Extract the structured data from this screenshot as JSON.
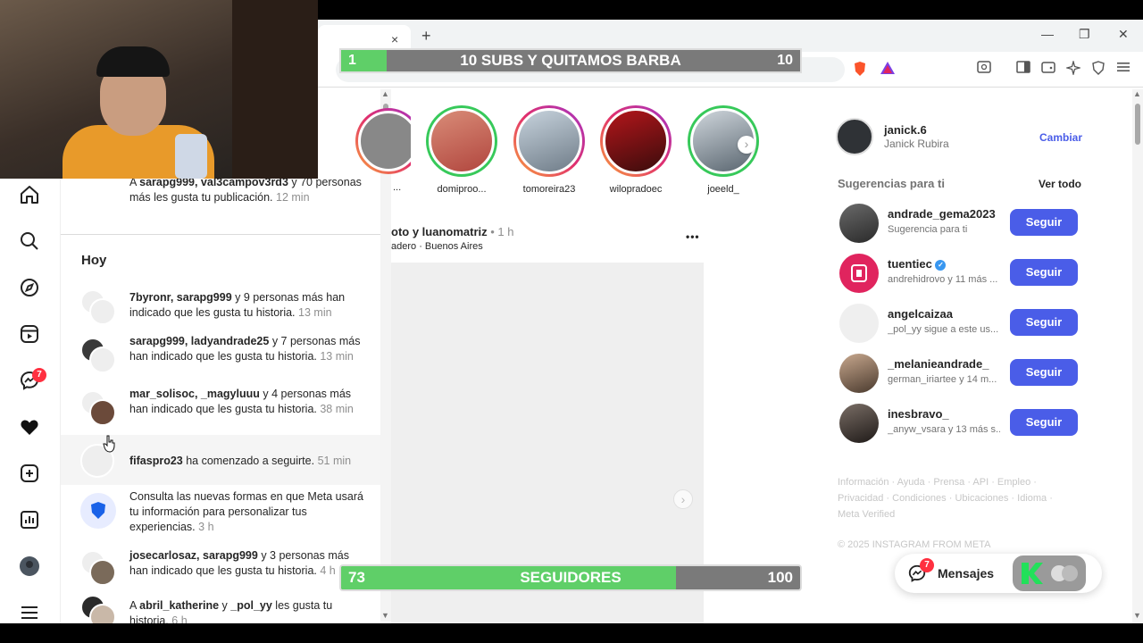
{
  "browser": {
    "tab_close": "×",
    "new_tab": "+",
    "minimize": "—",
    "restore": "❐",
    "close": "✕"
  },
  "overlay_top": {
    "left_value": "1",
    "title": "10 SUBS Y QUITAMOS BARBA",
    "right_value": "10",
    "progress_fraction": 0.1
  },
  "overlay_bottom": {
    "left_value": "73",
    "title": "SEGUIDORES",
    "right_value": "100",
    "progress_fraction": 0.73
  },
  "rail": {
    "notification_badge": "7"
  },
  "notifications": {
    "top_item": {
      "prefix": "A ",
      "users": "sarapg999, val3campov3rd3",
      "text": " y 70 personas más les gusta tu publicación.",
      "time": "12 min"
    },
    "section_title": "Hoy",
    "items": [
      {
        "users": "7byronr, sarapg999",
        "text": " y 9 personas más han indicado que les gusta tu historia.",
        "time": "13 min"
      },
      {
        "users": "sarapg999, ladyandrade25",
        "text": " y 7 personas más han indicado que les gusta tu historia.",
        "time": "13 min"
      },
      {
        "users": "mar_solisoc, _magyluuu",
        "text": " y 4 personas más han indicado que les gusta tu historia.",
        "time": "38 min"
      },
      {
        "users": "fifaspro23",
        "text": " ha comenzado a seguirte.",
        "time": "51 min"
      },
      {
        "users": "",
        "text": "Consulta las nuevas formas en que Meta usará tu información para personalizar tus experiencias.",
        "time": "3 h"
      },
      {
        "users": "josecarlosaz, sarapg999",
        "text": " y 3 personas más han indicado que les gusta tu historia.",
        "time": "4 h"
      },
      {
        "prefix": "A ",
        "users": "abril_katherine",
        "mid": " y ",
        "users2": "_pol_yy",
        "text": " les gusta tu historia.",
        "time": "6 h"
      }
    ]
  },
  "stories": [
    {
      "label": "domiproo..."
    },
    {
      "label": "tomoreira23"
    },
    {
      "label": "wilopradoec"
    },
    {
      "label": "joeeld_"
    }
  ],
  "partial_story_label": "...",
  "post": {
    "header": "oto y luanomatriz",
    "time": "• 1 h",
    "location": "adero · Buenos Aires",
    "more_icon": "•••",
    "next_icon": "›"
  },
  "profile": {
    "username": "janick.6",
    "fullname": "Janick Rubira",
    "switch_label": "Cambiar"
  },
  "suggestions": {
    "title": "Sugerencias para ti",
    "see_all": "Ver todo",
    "follow_label": "Seguir",
    "items": [
      {
        "name": "andrade_gema2023",
        "sub": "Sugerencia para ti"
      },
      {
        "name": "tuentiec",
        "sub": "andrehidrovo y 11 más ...",
        "verified": true
      },
      {
        "name": "angelcaizaa",
        "sub": "_pol_yy sigue a este us..."
      },
      {
        "name": "_melanieandrade_",
        "sub": "german_iriartee y 14 m..."
      },
      {
        "name": "inesbravo_",
        "sub": "_anyw_vsara y 13 más s..."
      }
    ]
  },
  "footer": {
    "line1": "Información · Ayuda · Prensa · API · Empleo ·",
    "line2": "Privacidad · Condiciones · Ubicaciones · Idioma ·",
    "line3": "Meta Verified",
    "copyright": "© 2025 INSTAGRAM FROM META"
  },
  "messages": {
    "label": "Mensajes",
    "badge": "7"
  },
  "colors": {
    "follow_blue": "#4a5de8",
    "badge_red": "#ff3040",
    "progress_green": "#5fcf68"
  }
}
